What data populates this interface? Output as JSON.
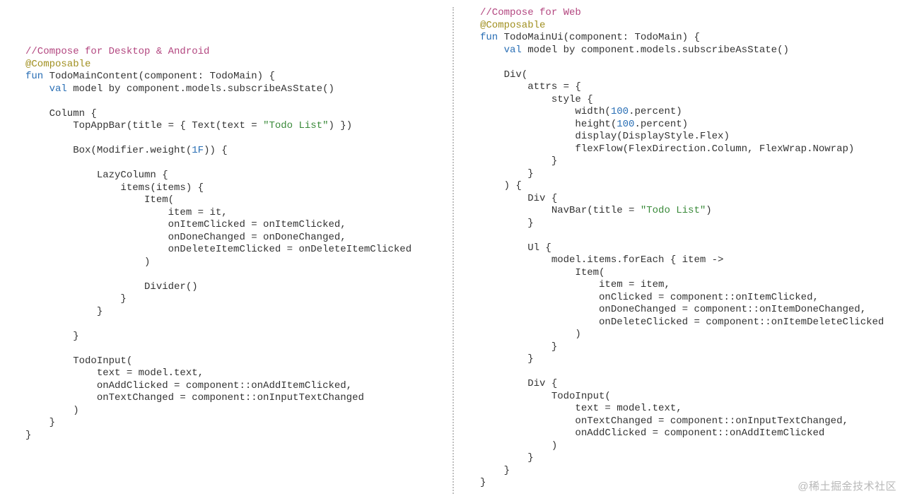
{
  "watermark": "@稀土掘金技术社区",
  "left": {
    "comment": "//Compose for Desktop & Android",
    "annotation": "@Composable",
    "fun_kw": "fun",
    "fun_sig": " TodoMainContent(component: TodoMain) {",
    "val_kw": "    val",
    "val_rest": " model by component.models.subscribeAsState()",
    "column": "    Column {",
    "topappbar_pre": "        TopAppBar(title = { Text(text = ",
    "topappbar_str": "\"Todo List\"",
    "topappbar_post": ") })",
    "box_pre": "        Box(Modifier.weight(",
    "box_num": "1F",
    "box_post": ")) {",
    "lazycol": "            LazyColumn {",
    "items_open": "                items(items) {",
    "item_open": "                    Item(",
    "item_eq": "                        item = it,",
    "onitem": "                        onItemClicked = onItemClicked,",
    "ondone": "                        onDoneChanged = onDoneChanged,",
    "ondel": "                        onDeleteItemClicked = onDeleteItemClicked",
    "item_close": "                    )",
    "divider": "                    Divider()",
    "items_close": "                }",
    "lazycol_close": "            }",
    "box_close": "        }",
    "todoinput_open": "        TodoInput(",
    "text_eq": "            text = model.text,",
    "onadd": "            onAddClicked = component::onAddItemClicked,",
    "ontext": "            onTextChanged = component::onInputTextChanged",
    "todoinput_close": "        )",
    "column_close": "    }",
    "fun_close": "}"
  },
  "right": {
    "comment": "//Compose for Web",
    "annotation": "@Composable",
    "fun_kw": "fun",
    "fun_sig": " TodoMainUi(component: TodoMain) {",
    "val_kw": "    val",
    "val_rest": " model by component.models.subscribeAsState()",
    "div_open": "    Div(",
    "attrs_open": "        attrs = {",
    "style_open": "            style {",
    "width_pre": "                width(",
    "width_num": "100",
    "width_post": ".percent)",
    "height_pre": "                height(",
    "height_num": "100",
    "height_post": ".percent)",
    "display": "                display(DisplayStyle.Flex)",
    "flexflow": "                flexFlow(FlexDirection.Column, FlexWrap.Nowrap)",
    "style_close": "            }",
    "attrs_close": "        }",
    "div_lambda": "    ) {",
    "inner_div_open": "        Div {",
    "navbar_pre": "            NavBar(title = ",
    "navbar_str": "\"Todo List\"",
    "navbar_post": ")",
    "inner_div_close": "        }",
    "ul_open": "        Ul {",
    "foreach": "            model.items.forEach { item ->",
    "item_open": "                Item(",
    "item_eq": "                    item = item,",
    "onclicked": "                    onClicked = component::onItemClicked,",
    "ondone": "                    onDoneChanged = component::onItemDoneChanged,",
    "ondel": "                    onDeleteClicked = component::onItemDeleteClicked",
    "item_close": "                )",
    "foreach_close": "            }",
    "ul_close": "        }",
    "div2_open": "        Div {",
    "todoinput_open": "            TodoInput(",
    "text_eq": "                text = model.text,",
    "ontext": "                onTextChanged = component::onInputTextChanged,",
    "onadd": "                onAddClicked = component::onAddItemClicked",
    "todoinput_close": "            )",
    "div2_close": "        }",
    "div_close": "    }",
    "fun_close": "}"
  }
}
